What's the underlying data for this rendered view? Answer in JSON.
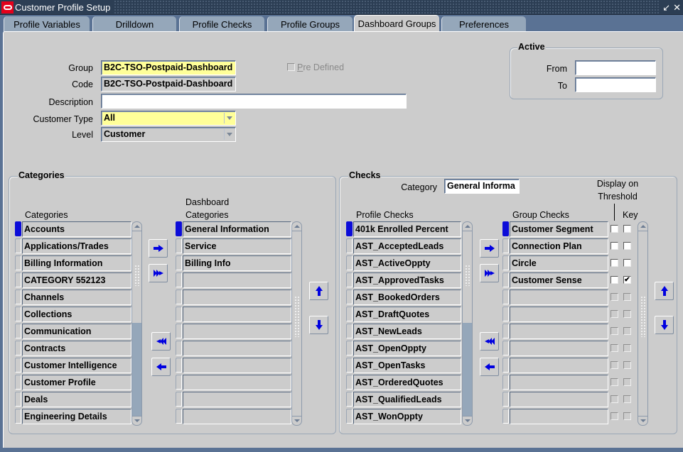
{
  "window": {
    "title": "Customer Profile Setup",
    "controls": {
      "minimize_icon": "minimize-icon",
      "close_icon": "close-icon"
    }
  },
  "tabs": [
    {
      "label": "Profile Variables",
      "active": false
    },
    {
      "label": "Drilldown",
      "active": false
    },
    {
      "label": "Profile Checks",
      "active": false
    },
    {
      "label": "Profile Groups",
      "active": false
    },
    {
      "label": "Dashboard Groups",
      "active": true
    },
    {
      "label": "Preferences",
      "active": false
    }
  ],
  "form": {
    "group_label": "Group",
    "group_value": "B2C-TSO-Postpaid-Dashboard",
    "code_label": "Code",
    "code_value": "B2C-TSO-Postpaid-Dashboard",
    "description_label": "Description",
    "description_value": "",
    "customer_type_label": "Customer Type",
    "customer_type_value": "All",
    "level_label": "Level",
    "level_value": "Customer",
    "predefined_label_mnemonic": "P",
    "predefined_label_rest": "re Defined",
    "predefined_checked": false
  },
  "active": {
    "title": "Active",
    "from_label": "From",
    "from_value": "",
    "to_label": "To",
    "to_value": ""
  },
  "categories_box": {
    "title": "Categories",
    "available_header": "Categories",
    "available": [
      "Accounts",
      "Applications/Trades",
      "Billing Information",
      "CATEGORY 552123",
      "Channels",
      "Collections",
      "Communication",
      "Contracts",
      "Customer Intelligence",
      "Customer Profile",
      "Deals",
      "Engineering Details"
    ],
    "selected_header_1": "Dashboard",
    "selected_header_2": "Categories",
    "selected": [
      "General Information",
      "Service",
      "Billing Info",
      "",
      "",
      "",
      "",
      "",
      "",
      "",
      "",
      ""
    ]
  },
  "checks_box": {
    "title": "Checks",
    "category_label": "Category",
    "category_value": "General Informa",
    "available_header": "Profile Checks",
    "available": [
      "401k Enrolled Percent",
      "AST_AcceptedLeads",
      "AST_ActiveOppty",
      "AST_ApprovedTasks",
      "AST_BookedOrders",
      "AST_DraftQuotes",
      "AST_NewLeads",
      "AST_OpenOppty",
      "AST_OpenTasks",
      "AST_OrderedQuotes",
      "AST_QualifiedLeads",
      "AST_WonOppty"
    ],
    "selected_header": "Group Checks",
    "display_threshold_header_1": "Display on",
    "display_threshold_header_2": "Threshold",
    "key_header": "Key",
    "selected": [
      {
        "name": "Customer Segment",
        "threshold": false,
        "key": false
      },
      {
        "name": "Connection Plan",
        "threshold": false,
        "key": false
      },
      {
        "name": "Circle",
        "threshold": false,
        "key": false
      },
      {
        "name": "Customer Sense",
        "threshold": false,
        "key": true
      },
      {
        "name": "",
        "threshold": false,
        "key": false
      },
      {
        "name": "",
        "threshold": false,
        "key": false
      },
      {
        "name": "",
        "threshold": false,
        "key": false
      },
      {
        "name": "",
        "threshold": false,
        "key": false
      },
      {
        "name": "",
        "threshold": false,
        "key": false
      },
      {
        "name": "",
        "threshold": false,
        "key": false
      },
      {
        "name": "",
        "threshold": false,
        "key": false
      },
      {
        "name": "",
        "threshold": false,
        "key": false
      }
    ]
  },
  "icons": {
    "move_right": "arrow-right-icon",
    "move_all_right": "double-arrow-right-icon",
    "move_all_left": "double-arrow-left-icon",
    "move_left": "arrow-left-icon",
    "move_up": "arrow-up-icon",
    "move_down": "arrow-down-icon",
    "checkmark": "✔"
  },
  "colors": {
    "accent_blue": "#0000e0",
    "required_field": "#ffff99",
    "row_indicator_current": "#0c0cd8"
  }
}
